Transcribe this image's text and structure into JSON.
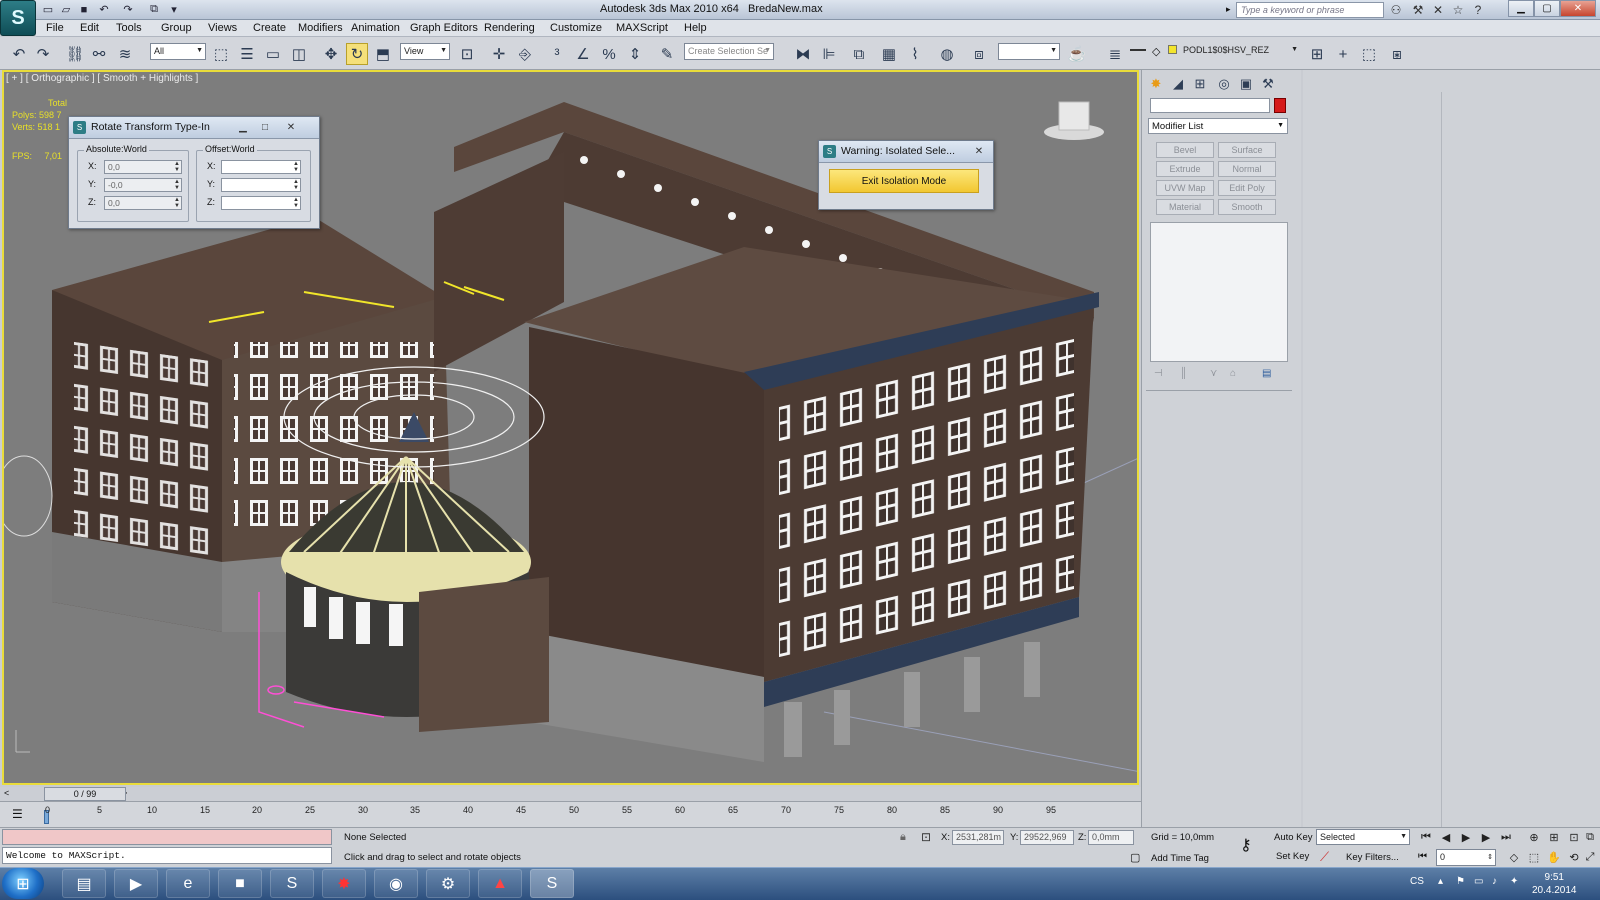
{
  "app": {
    "title": "Autodesk 3ds Max  2010 x64",
    "file": "BredaNew.max",
    "search_placeholder": "Type a keyword or phrase",
    "logo_icon": "3dsmax-logo-icon"
  },
  "menu": [
    "File",
    "Edit",
    "Tools",
    "Group",
    "Views",
    "Create",
    "Modifiers",
    "Animation",
    "Graph Editors",
    "Rendering",
    "Customize",
    "MAXScript",
    "Help"
  ],
  "toolbar": {
    "selection_filter": "All",
    "ref_coord": "View",
    "named_selection_placeholder": "Create Selection Se",
    "layer": "PODL1$0$HSV_REZ"
  },
  "viewport": {
    "label": "[ + ] [ Orthographic ] [ Smooth + Highlights ]",
    "stats_total_label": "Total",
    "polys_label": "Polys:",
    "polys_value": "598 7",
    "verts_label": "Verts:",
    "verts_value": "518 1",
    "fps_label": "FPS:",
    "fps_value": "7,01"
  },
  "rotate_dialog": {
    "title": "Rotate Transform Type-In",
    "absolute_label": "Absolute:World",
    "offset_label": "Offset:World",
    "abs": [
      {
        "axis": "X:",
        "value": "0,0"
      },
      {
        "axis": "Y:",
        "value": "-0,0"
      },
      {
        "axis": "Z:",
        "value": "0,0"
      }
    ],
    "off": [
      {
        "axis": "X:",
        "value": ""
      },
      {
        "axis": "Y:",
        "value": ""
      },
      {
        "axis": "Z:",
        "value": ""
      }
    ]
  },
  "warning_dialog": {
    "title": "Warning: Isolated Sele...",
    "button": "Exit Isolation Mode"
  },
  "command_panel": {
    "modifier_list": "Modifier List",
    "buttons": [
      "Bevel",
      "Surface",
      "Extrude",
      "Normal",
      "UVW Map",
      "Edit Poly",
      "Material",
      "Smooth"
    ]
  },
  "timeline": {
    "slider": "0 / 99",
    "ticks": [
      "0",
      "5",
      "10",
      "15",
      "20",
      "25",
      "30",
      "35",
      "40",
      "45",
      "50",
      "55",
      "60",
      "65",
      "70",
      "75",
      "80",
      "85",
      "90",
      "95"
    ]
  },
  "status": {
    "maxscript_output": "Welcome to MAXScript.",
    "selection": "None Selected",
    "prompt": "Click and drag to select and rotate objects",
    "x_label": "X:",
    "x": "2531,281m",
    "y_label": "Y:",
    "y": "29522,969",
    "z_label": "Z:",
    "z": "0,0mm",
    "grid": "Grid = 10,0mm",
    "add_time_tag": "Add Time Tag",
    "auto_key": "Auto Key",
    "set_key": "Set Key",
    "key_mode": "Selected",
    "key_filters": "Key Filters...",
    "frame": "0"
  },
  "taskbar": {
    "lang": "CS",
    "time": "9:51",
    "date": "20.4.2014",
    "apps": [
      "file-explorer-icon",
      "media-player-icon",
      "internet-explorer-icon",
      "terminal-icon",
      "skype-icon",
      "red-app-icon",
      "chrome-icon",
      "tool-icon",
      "acrobat-icon",
      "3dsmax-task-icon"
    ]
  }
}
